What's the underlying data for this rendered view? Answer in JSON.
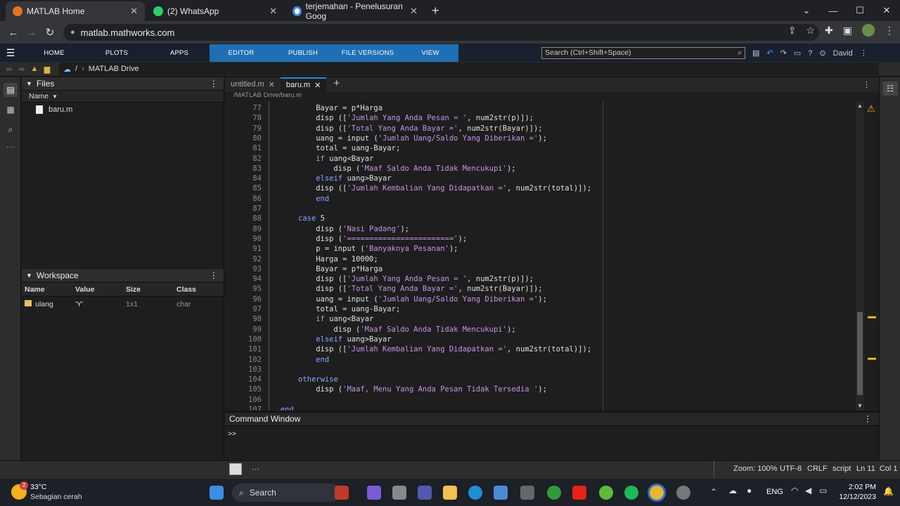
{
  "browser": {
    "tabs": [
      {
        "title": "MATLAB Home",
        "active": true
      },
      {
        "title": "(2) WhatsApp",
        "active": false
      },
      {
        "title": "terjemahan - Penelusuran Goog",
        "active": false
      }
    ],
    "new_tab": "+",
    "url": "matlab.mathworks.com"
  },
  "matlab": {
    "toolstrip_tabs": [
      "HOME",
      "PLOTS",
      "APPS",
      "EDITOR",
      "PUBLISH",
      "FILE VERSIONS",
      "VIEW"
    ],
    "search_placeholder": "Search (Ctrl+Shift+Space)",
    "user": "David",
    "path": {
      "root": "/",
      "folder": "MATLAB Drive"
    },
    "files_panel": {
      "title": "Files",
      "column": "Name",
      "items": [
        "baru.m"
      ]
    },
    "workspace_panel": {
      "title": "Workspace",
      "columns": [
        "Name",
        "Value",
        "Size",
        "Class"
      ],
      "rows": [
        {
          "name": "ulang",
          "value": "'Y'",
          "size": "1x1",
          "class": "char"
        }
      ]
    },
    "editor_tabs": [
      "untitled.m",
      "baru.m"
    ],
    "file_path": "/MATLAB Drive/baru.m",
    "code_lines": [
      {
        "n": "77",
        "indent": 4,
        "parts": [
          [
            "Bayar = p*Harga",
            ""
          ]
        ]
      },
      {
        "n": "78",
        "indent": 4,
        "parts": [
          [
            "disp ([",
            ""
          ],
          [
            "'Jumlah Yang Anda Pesan = '",
            "st"
          ],
          [
            ", num2str(p)]);",
            ""
          ]
        ]
      },
      {
        "n": "79",
        "indent": 4,
        "parts": [
          [
            "disp ([",
            ""
          ],
          [
            "'Total Yang Anda Bayar ='",
            "st"
          ],
          [
            ", num2str(Bayar)]);",
            ""
          ]
        ]
      },
      {
        "n": "80",
        "indent": 4,
        "parts": [
          [
            "uang = input (",
            ""
          ],
          [
            "'Jumlah Uang/Saldo Yang Diberikan ='",
            "st"
          ],
          [
            ");",
            ""
          ]
        ]
      },
      {
        "n": "81",
        "indent": 4,
        "parts": [
          [
            "total = uang-Bayar;",
            ""
          ]
        ]
      },
      {
        "n": "82",
        "indent": 4,
        "parts": [
          [
            "if",
            "kw"
          ],
          [
            " uang<Bayar",
            ""
          ]
        ]
      },
      {
        "n": "83",
        "indent": 8,
        "parts": [
          [
            "disp (",
            ""
          ],
          [
            "'Maaf Saldo Anda Tidak Mencukupi'",
            "st"
          ],
          [
            ");",
            ""
          ]
        ]
      },
      {
        "n": "84",
        "indent": 4,
        "parts": [
          [
            "elseif",
            "kw"
          ],
          [
            " uang>Bayar",
            ""
          ]
        ]
      },
      {
        "n": "85",
        "indent": 4,
        "parts": [
          [
            "disp ([",
            ""
          ],
          [
            "'Jumlah Kembalian Yang Didapatkan ='",
            "st"
          ],
          [
            ", num2str(total)]);",
            ""
          ]
        ]
      },
      {
        "n": "86",
        "indent": 4,
        "parts": [
          [
            "end",
            "kw"
          ]
        ]
      },
      {
        "n": "87",
        "indent": 0,
        "parts": []
      },
      {
        "n": "88",
        "indent": 0,
        "parts": [
          [
            "case",
            "kw"
          ],
          [
            " 5",
            ""
          ]
        ]
      },
      {
        "n": "89",
        "indent": 4,
        "parts": [
          [
            "disp (",
            ""
          ],
          [
            "'Nasi Padang'",
            "st"
          ],
          [
            ");",
            ""
          ]
        ]
      },
      {
        "n": "90",
        "indent": 4,
        "parts": [
          [
            "disp (",
            ""
          ],
          [
            "'========================'",
            "st"
          ],
          [
            ");",
            ""
          ]
        ]
      },
      {
        "n": "91",
        "indent": 4,
        "parts": [
          [
            "p = input (",
            ""
          ],
          [
            "'Banyaknya Pesanan'",
            "st"
          ],
          [
            ");",
            ""
          ]
        ]
      },
      {
        "n": "92",
        "indent": 4,
        "parts": [
          [
            "Harga = 10000;",
            ""
          ]
        ]
      },
      {
        "n": "93",
        "indent": 4,
        "parts": [
          [
            "Bayar = p*Harga",
            ""
          ]
        ]
      },
      {
        "n": "94",
        "indent": 4,
        "parts": [
          [
            "disp ([",
            ""
          ],
          [
            "'Jumlah Yang Anda Pesan = '",
            "st"
          ],
          [
            ", num2str(p)]);",
            ""
          ]
        ]
      },
      {
        "n": "95",
        "indent": 4,
        "parts": [
          [
            "disp ([",
            ""
          ],
          [
            "'Total Yang Anda Bayar ='",
            "st"
          ],
          [
            ", num2str(Bayar)]);",
            ""
          ]
        ]
      },
      {
        "n": "96",
        "indent": 4,
        "parts": [
          [
            "uang = input (",
            ""
          ],
          [
            "'Jumlah Uang/Saldo Yang Diberikan ='",
            "st"
          ],
          [
            ");",
            ""
          ]
        ]
      },
      {
        "n": "97",
        "indent": 4,
        "parts": [
          [
            "total = uang-Bayar;",
            ""
          ]
        ]
      },
      {
        "n": "98",
        "indent": 4,
        "parts": [
          [
            "if",
            "kw"
          ],
          [
            " uang<Bayar",
            ""
          ]
        ]
      },
      {
        "n": "99",
        "indent": 8,
        "parts": [
          [
            "disp (",
            ""
          ],
          [
            "'Maaf Saldo Anda Tidak Mencukupi'",
            "st"
          ],
          [
            ");",
            ""
          ]
        ]
      },
      {
        "n": "100",
        "indent": 4,
        "parts": [
          [
            "elseif",
            "kw"
          ],
          [
            " uang>Bayar",
            ""
          ]
        ]
      },
      {
        "n": "101",
        "indent": 4,
        "parts": [
          [
            "disp ([",
            ""
          ],
          [
            "'Jumlah Kembalian Yang Didapatkan ='",
            "st"
          ],
          [
            ", num2str(total)]);",
            ""
          ]
        ]
      },
      {
        "n": "102",
        "indent": 4,
        "parts": [
          [
            "end",
            "kw"
          ]
        ]
      },
      {
        "n": "103",
        "indent": 0,
        "parts": []
      },
      {
        "n": "104",
        "indent": 0,
        "parts": [
          [
            "otherwise",
            "kw"
          ]
        ]
      },
      {
        "n": "105",
        "indent": 4,
        "parts": [
          [
            "disp (",
            ""
          ],
          [
            "'Maaf, Menu Yang Anda Pesan Tidak Tersedia '",
            "st"
          ],
          [
            ");",
            ""
          ]
        ]
      },
      {
        "n": "106",
        "indent": 0,
        "parts": []
      },
      {
        "n": "107",
        "indent": -4,
        "parts": [
          [
            "end",
            "kw"
          ]
        ]
      }
    ],
    "command_window": {
      "title": "Command Window",
      "prompt": ">>"
    },
    "status": {
      "zoom": "Zoom: 100%",
      "encoding": "UTF-8",
      "eol": "CRLF",
      "type": "script",
      "position": "Ln 11  Col 1"
    }
  },
  "taskbar": {
    "weather": {
      "temp": "33°C",
      "desc": "Sebagian cerah",
      "badge": "2"
    },
    "search": "Search",
    "lang": "ENG",
    "time": "2:02 PM",
    "date": "12/12/2023"
  }
}
